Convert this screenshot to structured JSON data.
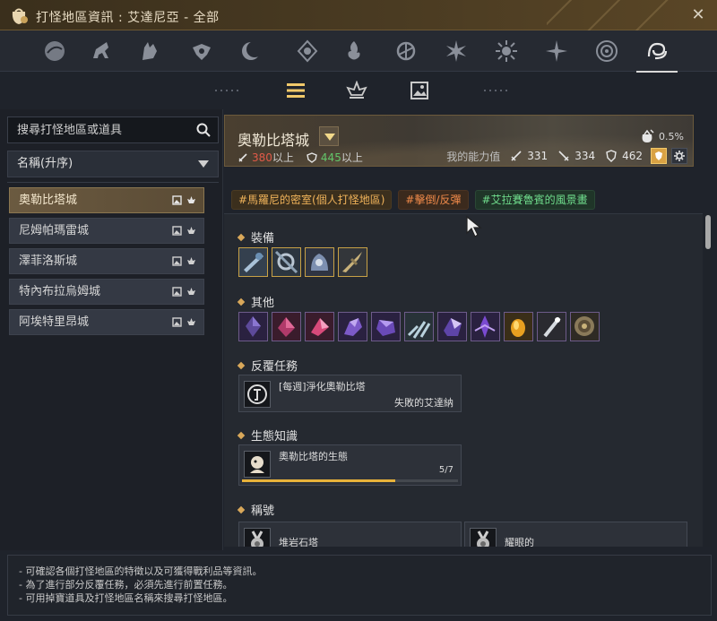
{
  "window": {
    "title": "打怪地區資訊 : 艾達尼亞 - 全部",
    "close_icon": "close-icon"
  },
  "category_tabs": [
    {
      "icon": "bird-icon",
      "active": false
    },
    {
      "icon": "horse-icon",
      "active": false
    },
    {
      "icon": "wolf-icon",
      "active": false
    },
    {
      "icon": "winged-emblem-icon",
      "active": false
    },
    {
      "icon": "crescent-moon-icon",
      "active": false
    },
    {
      "icon": "diamond-emblem-icon",
      "active": false
    },
    {
      "icon": "flame-emblem-icon",
      "active": false
    },
    {
      "icon": "triskelion-icon",
      "active": false
    },
    {
      "icon": "starburst-icon",
      "active": false
    },
    {
      "icon": "sun-icon",
      "active": false
    },
    {
      "icon": "compass-star-icon",
      "active": false
    },
    {
      "icon": "mandala-icon",
      "active": false
    },
    {
      "icon": "swirl-emblem-icon",
      "active": true
    }
  ],
  "view_tabs": [
    {
      "icon": "list-icon",
      "active": true
    },
    {
      "icon": "monster-icon",
      "active": false
    },
    {
      "icon": "image-icon",
      "active": false
    }
  ],
  "search": {
    "placeholder": "搜尋打怪地區或道具"
  },
  "sort": {
    "selected": "名稱(升序)"
  },
  "map_list": [
    {
      "name": "奧勒比塔城",
      "active": true
    },
    {
      "name": "尼姆帕瑪雷城",
      "active": false
    },
    {
      "name": "澤菲洛斯城",
      "active": false
    },
    {
      "name": "特內布拉烏姆城",
      "active": false
    },
    {
      "name": "阿埃特里昂城",
      "active": false
    }
  ],
  "header": {
    "title": "奧勒比塔城",
    "attack_req": "380",
    "defense_req": "445",
    "suffix": "以上",
    "drop_rate": "0.5%",
    "my_stats_label": "我的能力值",
    "my_attack": "331",
    "my_attack2": "334",
    "my_defense": "462"
  },
  "tags": [
    "#馬羅尼的密室(個人打怪地區)",
    "#擊倒/反彈",
    "#艾拉賽魯賓的風景畫"
  ],
  "sections": {
    "equipment": "裝備",
    "other": "其他",
    "repeat_quests": "反覆任務",
    "ecology": "生態知識",
    "titles": "稱號"
  },
  "quest": {
    "title": "[每週]淨化奧勒比塔",
    "npc": "失敗的艾達納"
  },
  "ecology_card": {
    "title": "奧勒比塔的生態",
    "progress_text": "5/7",
    "progress": 0.71
  },
  "title_cards": [
    {
      "name": "堆岩石塔"
    },
    {
      "name": "耀眼的"
    }
  ],
  "footer_lines": [
    "- 可確認各個打怪地區的特徵以及可獲得戰利品等資訊。",
    "- 為了進行部分反覆任務，必須先進行前置任務。",
    "- 可用掉寶道具及打怪地區名稱來搜尋打怪地區。"
  ],
  "colors": {
    "accent_gold": "#f0c86a",
    "req_red": "#e05a48",
    "req_green": "#62c66a",
    "progress_fill": "#e8b23a"
  }
}
